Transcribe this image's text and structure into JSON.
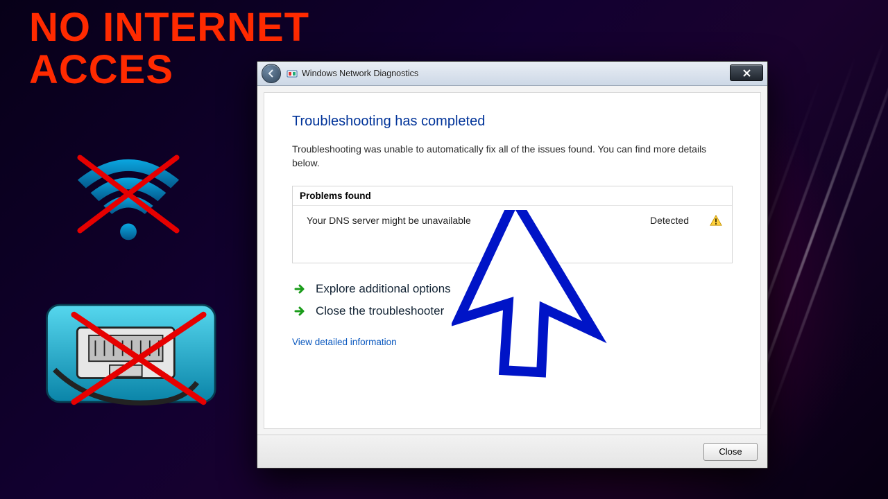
{
  "overlay": {
    "headline_line1": "NO INTERNET",
    "headline_line2": "ACCES"
  },
  "dialog": {
    "window_title": "Windows Network Diagnostics",
    "heading": "Troubleshooting has completed",
    "subtext": "Troubleshooting was unable to automatically fix all of the issues found. You can find more details below.",
    "problems_header": "Problems found",
    "problem": {
      "description": "Your DNS server might be unavailable",
      "status": "Detected"
    },
    "option_explore": "Explore additional options",
    "option_close_ts": "Close the troubleshooter",
    "detailed_link": "View detailed information",
    "close_button": "Close"
  }
}
